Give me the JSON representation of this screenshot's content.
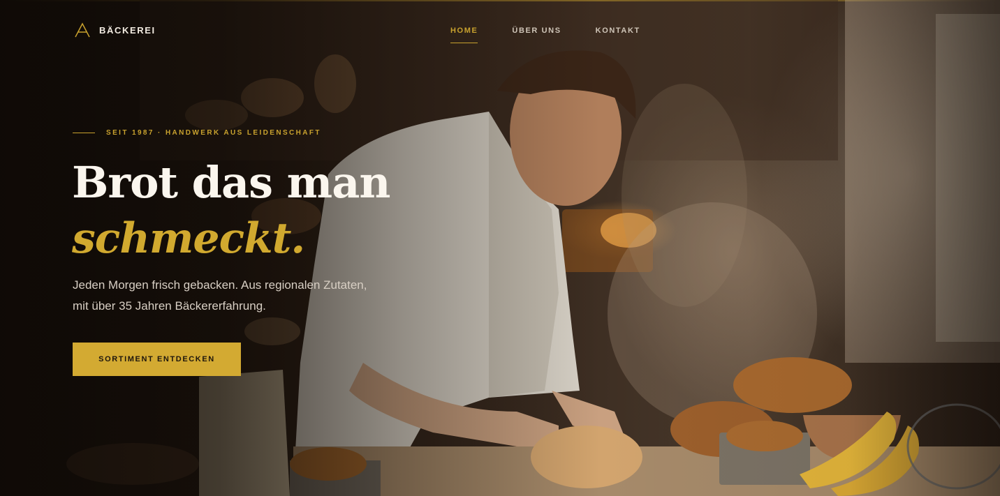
{
  "brand": {
    "name": "BÄCKEREI",
    "icon": "logo-a-icon"
  },
  "nav": {
    "items": [
      {
        "label": "HOME",
        "active": true
      },
      {
        "label": "ÜBER UNS",
        "active": false
      },
      {
        "label": "KONTAKT",
        "active": false
      }
    ]
  },
  "hero": {
    "eyebrow": "SEIT 1987 · HANDWERK AUS LEIDENSCHAFT",
    "title_line1": "Brot das man",
    "title_line2": "schmeckt.",
    "lead": "Jeden Morgen frisch gebacken. Aus regionalen Zutaten, mit über 35 Jahren Bäckererfahrung.",
    "cta_label": "SORTIMENT ENTDECKEN",
    "background": "baker-kneading-dough-photo"
  },
  "colors": {
    "accent": "#c9a22e",
    "title": "#fbf6ee",
    "text": "#d8cfc4",
    "background": "#1a120c"
  }
}
